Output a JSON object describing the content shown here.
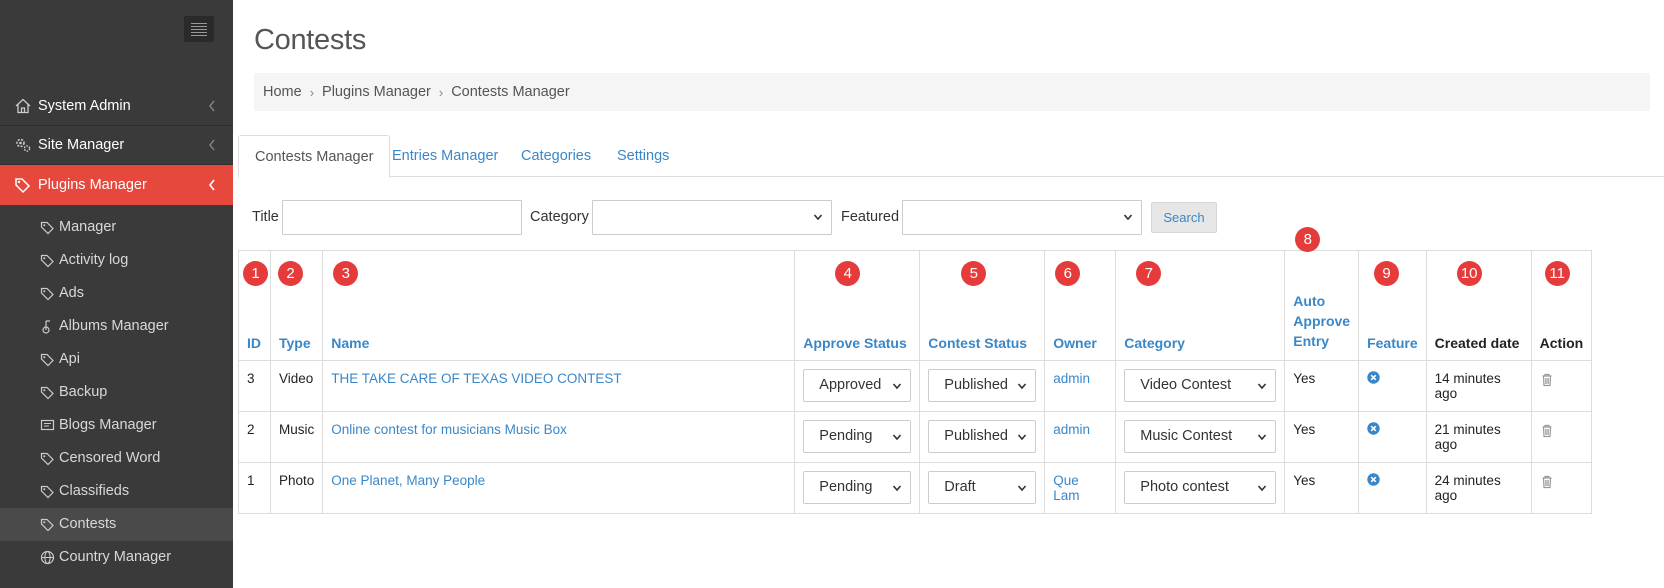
{
  "sidebar": {
    "menu_icon": "hamburger-icon",
    "sections": [
      {
        "label": "System Admin",
        "icon": "home-icon"
      },
      {
        "label": "Site Manager",
        "icon": "gears-icon"
      },
      {
        "label": "Plugins Manager",
        "icon": "tags-icon"
      }
    ],
    "items": [
      {
        "label": "Manager",
        "icon": "tag-icon"
      },
      {
        "label": "Activity log",
        "icon": "tag-icon"
      },
      {
        "label": "Ads",
        "icon": "tag-icon"
      },
      {
        "label": "Albums Manager",
        "icon": "album-icon"
      },
      {
        "label": "Api",
        "icon": "tag-icon"
      },
      {
        "label": "Backup",
        "icon": "tag-icon"
      },
      {
        "label": "Blogs Manager",
        "icon": "blog-icon"
      },
      {
        "label": "Censored Word",
        "icon": "tag-icon"
      },
      {
        "label": "Classifieds",
        "icon": "tag-icon"
      },
      {
        "label": "Contests",
        "icon": "tag-icon"
      },
      {
        "label": "Country Manager",
        "icon": "globe-icon"
      }
    ]
  },
  "page": {
    "title": "Contests",
    "breadcrumb": [
      "Home",
      "Plugins Manager",
      "Contests Manager"
    ]
  },
  "tabs": [
    "Contests Manager",
    "Entries Manager",
    "Categories",
    "Settings"
  ],
  "filters": {
    "title_label": "Title",
    "title_value": "",
    "category_label": "Category",
    "category_value": "",
    "featured_label": "Featured",
    "featured_value": "",
    "search_label": "Search"
  },
  "table": {
    "headers": [
      {
        "label": "ID",
        "badge": "1"
      },
      {
        "label": "Type",
        "badge": "2"
      },
      {
        "label": "Name",
        "badge": "3"
      },
      {
        "label": "Approve Status",
        "badge": "4"
      },
      {
        "label": "Contest Status",
        "badge": "5"
      },
      {
        "label": "Owner",
        "badge": "6"
      },
      {
        "label": "Category",
        "badge": "7"
      },
      {
        "label": "Auto\nApprove\nEntry",
        "badge": "8"
      },
      {
        "label": "Feature",
        "badge": "9"
      },
      {
        "label": "Created date",
        "badge": "10"
      },
      {
        "label": "Action",
        "badge": "11"
      }
    ],
    "rows": [
      {
        "id": "3",
        "type": "Video",
        "name": "THE TAKE CARE OF TEXAS VIDEO CONTEST",
        "approve_status": "Approved",
        "contest_status": "Published",
        "owner": "admin",
        "category": "Video Contest",
        "auto_approve": "Yes",
        "created": "14 minutes ago"
      },
      {
        "id": "2",
        "type": "Music",
        "name": "Online contest for musicians Music Box",
        "approve_status": "Pending",
        "contest_status": "Published",
        "owner": "admin",
        "category": "Music Contest",
        "auto_approve": "Yes",
        "created": "21 minutes ago"
      },
      {
        "id": "1",
        "type": "Photo",
        "name": "One Planet, Many People",
        "approve_status": "Pending",
        "contest_status": "Draft",
        "owner": "Que Lam",
        "category": "Photo contest",
        "auto_approve": "Yes",
        "created": "24 minutes ago"
      }
    ],
    "feature_icon": "close-circle-icon",
    "action_icon": "trash-icon"
  },
  "colors": {
    "sidebar_bg": "#3a3a3a",
    "active_bg": "#e6483d",
    "link": "#3a87c8",
    "badge": "#e63b3b"
  }
}
